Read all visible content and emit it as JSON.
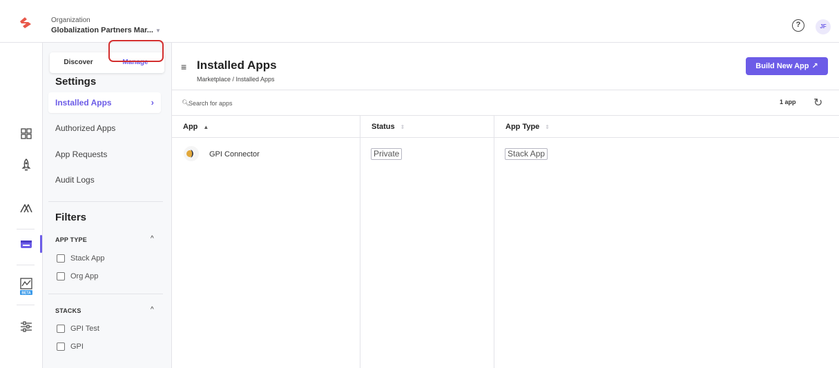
{
  "header": {
    "org_label": "Organization",
    "org_name": "Globalization Partners Mar...",
    "help_icon": "help-circle-icon",
    "avatar_initials": "JF"
  },
  "brand": {
    "logo_icon": "contentstack-logo",
    "accent": "#6c5ce7",
    "highlight_ring": "#d32f2f"
  },
  "left_nav": {
    "icons": [
      "dashboard-grid-icon",
      "rocket-icon",
      "automate-icon",
      "marketplace-store-icon",
      "analytics-beta-icon",
      "settings-sliders-icon"
    ],
    "beta_badge": "BETA",
    "active": "marketplace-store-icon"
  },
  "side_panel": {
    "tabs": {
      "discover": "Discover",
      "manage": "Manage"
    },
    "settings_title": "Settings",
    "items": [
      {
        "label": "Installed Apps",
        "active": true
      },
      {
        "label": "Authorized Apps",
        "active": false
      },
      {
        "label": "App Requests",
        "active": false
      },
      {
        "label": "Audit Logs",
        "active": false
      }
    ],
    "filters_title": "Filters",
    "app_type": {
      "heading": "APP TYPE",
      "options": [
        "Stack App",
        "Org App"
      ]
    },
    "stacks": {
      "heading": "STACKS",
      "options": [
        "GPI Test",
        "GPI"
      ]
    }
  },
  "main": {
    "title": "Installed Apps",
    "breadcrumb": "Marketplace / Installed Apps",
    "build_button": "Build New App",
    "search_placeholder": "Search for apps",
    "app_count": "1 app",
    "columns": [
      "App",
      "Status",
      "App Type"
    ],
    "rows": [
      {
        "app": "GPI Connector",
        "status": "Private",
        "app_type": "Stack App"
      }
    ]
  }
}
